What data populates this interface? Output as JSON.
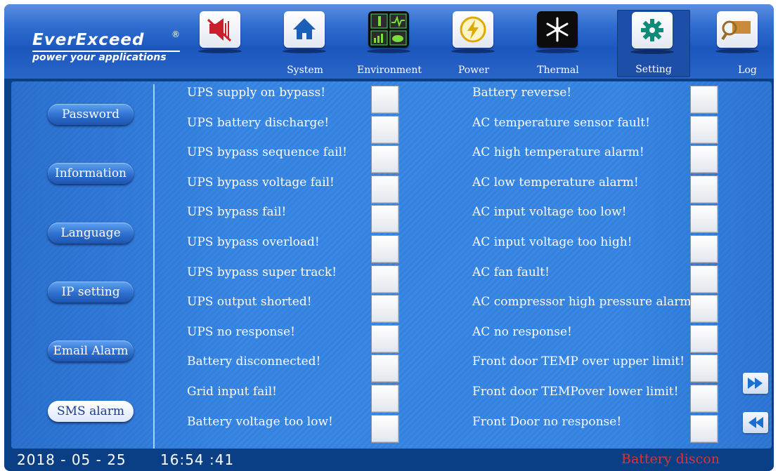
{
  "brand": {
    "name": "EverExceed",
    "registered": "®",
    "tagline": "power your applications"
  },
  "toolbar": [
    {
      "id": "mute",
      "label": "",
      "icon": "mute-speaker-icon"
    },
    {
      "id": "system",
      "label": "System",
      "icon": "home-icon"
    },
    {
      "id": "environment",
      "label": "Environment",
      "icon": "environment-monitor-icon"
    },
    {
      "id": "power",
      "label": "Power",
      "icon": "lightning-icon"
    },
    {
      "id": "thermal",
      "label": "Thermal",
      "icon": "snowflake-icon"
    },
    {
      "id": "setting",
      "label": "Setting",
      "icon": "gear-icon",
      "active": true
    },
    {
      "id": "log",
      "label": "Log",
      "icon": "magnifier-log-icon"
    }
  ],
  "sidebar": {
    "items": [
      {
        "label": "Password"
      },
      {
        "label": "Information"
      },
      {
        "label": "Language"
      },
      {
        "label": "IP setting"
      },
      {
        "label": "Email Alarm"
      },
      {
        "label": "SMS alarm",
        "selected": true
      }
    ]
  },
  "alarms": {
    "left": [
      "UPS supply on bypass!",
      "UPS battery discharge!",
      "UPS bypass sequence fail!",
      "UPS bypass voltage fail!",
      "UPS bypass fail!",
      "UPS bypass overload!",
      "UPS bypass super track!",
      "UPS output shorted!",
      "UPS no response!",
      "Battery disconnected!",
      "Grid input fail!",
      "Battery voltage too low!"
    ],
    "right": [
      "Battery reverse!",
      "AC temperature sensor fault!",
      "AC high temperature alarm!",
      "AC low temperature alarm!",
      "AC input voltage too low!",
      "AC input voltage too high!",
      "AC fan fault!",
      "AC compressor high pressure alarm!",
      "AC no response!",
      "Front door TEMP over upper limit!",
      "Front door TEMPover lower limit!",
      "Front Door no response!"
    ]
  },
  "nav": {
    "next_icon": "fast-forward-icon",
    "prev_icon": "rewind-icon"
  },
  "footer": {
    "date": "2018 - 05 - 25",
    "time": "16:54 :41",
    "status": "Battery discon"
  },
  "colors": {
    "accent": "#3b87e4",
    "status": "#e0332b",
    "header": "#1c57bd"
  }
}
